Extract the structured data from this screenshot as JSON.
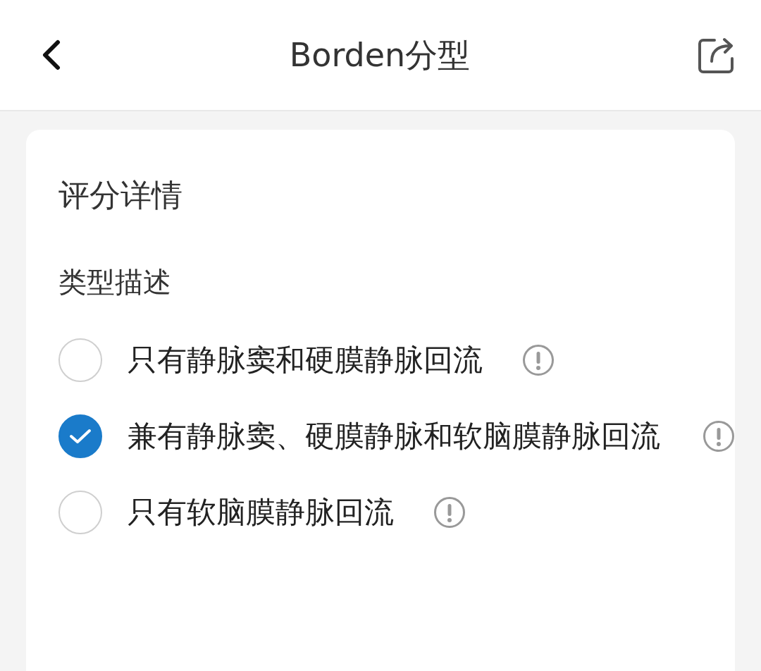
{
  "header": {
    "title": "Borden分型"
  },
  "card": {
    "title": "评分详情",
    "section": "类型描述",
    "options": [
      {
        "label": "只有静脉窦和硬膜静脉回流",
        "selected": false
      },
      {
        "label": "兼有静脉窦、硬膜静脉和软脑膜静脉回流",
        "selected": true
      },
      {
        "label": "只有软脑膜静脉回流",
        "selected": false
      }
    ]
  }
}
